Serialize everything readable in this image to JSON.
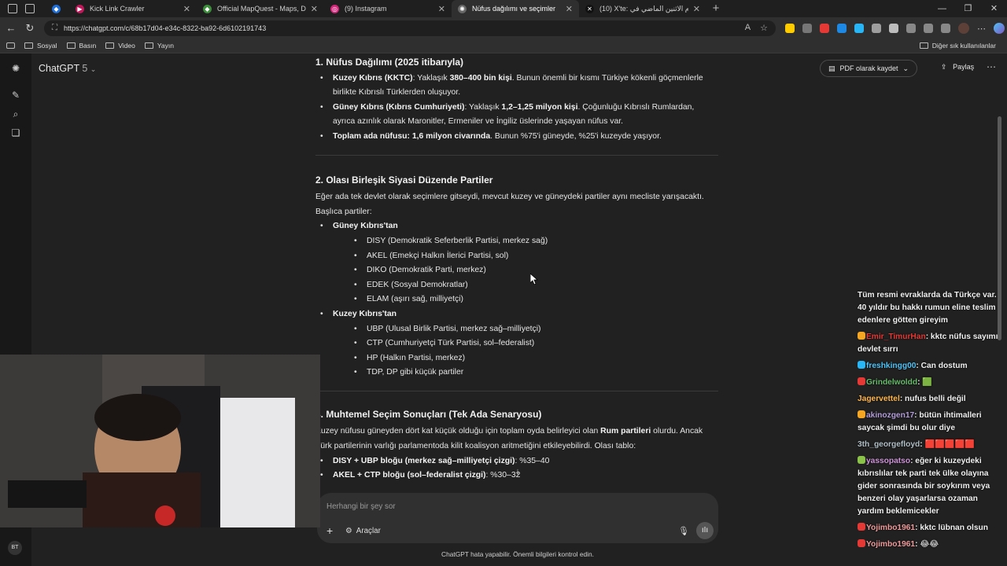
{
  "browser": {
    "tabs": [
      {
        "title": "Kick Link Crawler",
        "fav_color": "#c2185b",
        "fav_glyph": "▶",
        "active": false
      },
      {
        "title": "Official MapQuest - Maps, D",
        "fav_color": "#3b8f3b",
        "fav_glyph": "◆",
        "active": false
      },
      {
        "title": "(9) Instagram",
        "fav_color": "#d6247a",
        "fav_glyph": "◎",
        "active": false
      },
      {
        "title": "Nüfus dağılımı ve seçimler",
        "fav_color": "#666666",
        "fav_glyph": "✺",
        "active": true
      },
      {
        "title": "(10) X'te: يوم الاثنين الماضي في",
        "fav_color": "#111111",
        "fav_glyph": "✕",
        "active": false
      }
    ],
    "url": "https://chatgpt.com/c/68b17d04-e34c-8322-ba92-6d6102191743",
    "bookmarks": [
      "Sosyal",
      "Basın",
      "Video",
      "Yayın"
    ],
    "bookmarks_right": "Diğer sık kullanılanlar"
  },
  "chatgpt": {
    "model_name": "ChatGPT",
    "model_version": "5",
    "pdf_button": "PDF olarak kaydet",
    "share_button": "Paylaş",
    "composer_placeholder": "Herhangi bir şey sor",
    "tools_label": "Araçlar",
    "disclaimer": "ChatGPT hata yapabilir. Önemli bilgileri kontrol edin.",
    "user_initials": "BT"
  },
  "article": {
    "s1": {
      "heading": "1. Nüfus Dağılımı (2025 itibarıyla)",
      "b1_label": "Kuzey Kıbrıs (KKTC)",
      "b1_pre": ": Yaklaşık ",
      "b1_bold": "380–400 bin kişi",
      "b1_post": ". Bunun önemli bir kısmı Türkiye kökenli göçmenlerle birlikte Kıbrıslı Türklerden oluşuyor.",
      "b2_label": "Güney Kıbrıs (Kıbrıs Cumhuriyeti)",
      "b2_pre": ": Yaklaşık ",
      "b2_bold": "1,2–1,25 milyon kişi",
      "b2_post": ". Çoğunluğu Kıbrıslı Rumlardan, ayrıca azınlık olarak Maronitler, Ermeniler ve İngiliz üslerinde yaşayan nüfus var.",
      "b3_bold": "Toplam ada nüfusu: 1,6 milyon civarında",
      "b3_post": ". Bunun %75'i güneyde, %25'i kuzeyde yaşıyor."
    },
    "s2": {
      "heading": "2. Olası Birleşik Siyasi Düzende Partiler",
      "intro": "Eğer ada tek devlet olarak seçimlere gitseydi, mevcut kuzey ve güneydeki partiler aynı mecliste yarışacaktı. Başlıca partiler:",
      "south_label": "Güney Kıbrıs'tan",
      "south": [
        "DISY (Demokratik Seferberlik Partisi, merkez sağ)",
        "AKEL (Emekçi Halkın İlerici Partisi, sol)",
        "DIKO (Demokratik Parti, merkez)",
        "EDEK (Sosyal Demokratlar)",
        "ELAM (aşırı sağ, milliyetçi)"
      ],
      "north_label": "Kuzey Kıbrıs'tan",
      "north": [
        "UBP (Ulusal Birlik Partisi, merkez sağ–milliyetçi)",
        "CTP (Cumhuriyetçi Türk Partisi, sol–federalist)",
        "HP (Halkın Partisi, merkez)",
        "TDP, DP gibi küçük partiler"
      ]
    },
    "s3": {
      "heading": "3. Muhtemel Seçim Sonuçları (Tek Ada Senaryosu)",
      "intro_pre": "Kuzey nüfusu güneyden dört kat küçük olduğu için toplam oyda belirleyici olan ",
      "intro_bold": "Rum partileri",
      "intro_post": " olurdu. Ancak Türk partilerinin varlığı parlamentoda kilit koalisyon aritmetiğini etkileyebilirdi. Olası tablo:",
      "b1_bold": "DISY + UBP bloğu (merkez sağ–milliyetçi çizgi)",
      "b1_post": ": %35–40",
      "b2_bold": "AKEL + CTP bloğu (sol–federalist çizgi)",
      "b2_post": ": %30–32"
    }
  },
  "chat_overlay": [
    {
      "user": "",
      "user_color": "#ffffff",
      "text": "Tüm resmi evraklarda da Türkçe var. 40 yıldır bu hakkı rumun eline teslim edenlere götten gireyim",
      "badge_color": ""
    },
    {
      "user": "Emir_TimurHan",
      "user_color": "#e53935",
      "text": "kktc nüfus sayımı devlet sırrı",
      "badge_color": "#f5a623"
    },
    {
      "user": "freshkingg00",
      "user_color": "#4fc3f7",
      "text": "Can dostum",
      "badge_color": "#29b6f6"
    },
    {
      "user": "Grindelwoldd",
      "user_color": "#66bb6a",
      "text": "🟩",
      "badge_color": "#e53935"
    },
    {
      "user": "Jagervettel",
      "user_color": "#ffb74d",
      "text": "nufus belli değil",
      "badge_color": ""
    },
    {
      "user": "akinozgen17",
      "user_color": "#b39ddb",
      "text": "bütün ihtimalleri saycak şimdi bu olur diye",
      "badge_color": "#f5a623"
    },
    {
      "user": "3th_georgefloyd",
      "user_color": "#b0bec5",
      "text": "🟥🟥🟥🟥🟥",
      "badge_color": ""
    },
    {
      "user": "yassopatso",
      "user_color": "#ce93d8",
      "text": "eğer ki kuzeydeki kıbrıslılar tek parti tek ülke olayına gider sonrasında bir soykırım veya benzeri olay yaşarlarsa ozaman yardım beklemicekler",
      "badge_color": "#8bc34a"
    },
    {
      "user": "Yojimbo1961",
      "user_color": "#ef9a9a",
      "text": "kktc lübnan olsun",
      "badge_color": "#e53935"
    },
    {
      "user": "Yojimbo1961",
      "user_color": "#ef9a9a",
      "text": "😂😂",
      "badge_color": "#e53935"
    }
  ]
}
